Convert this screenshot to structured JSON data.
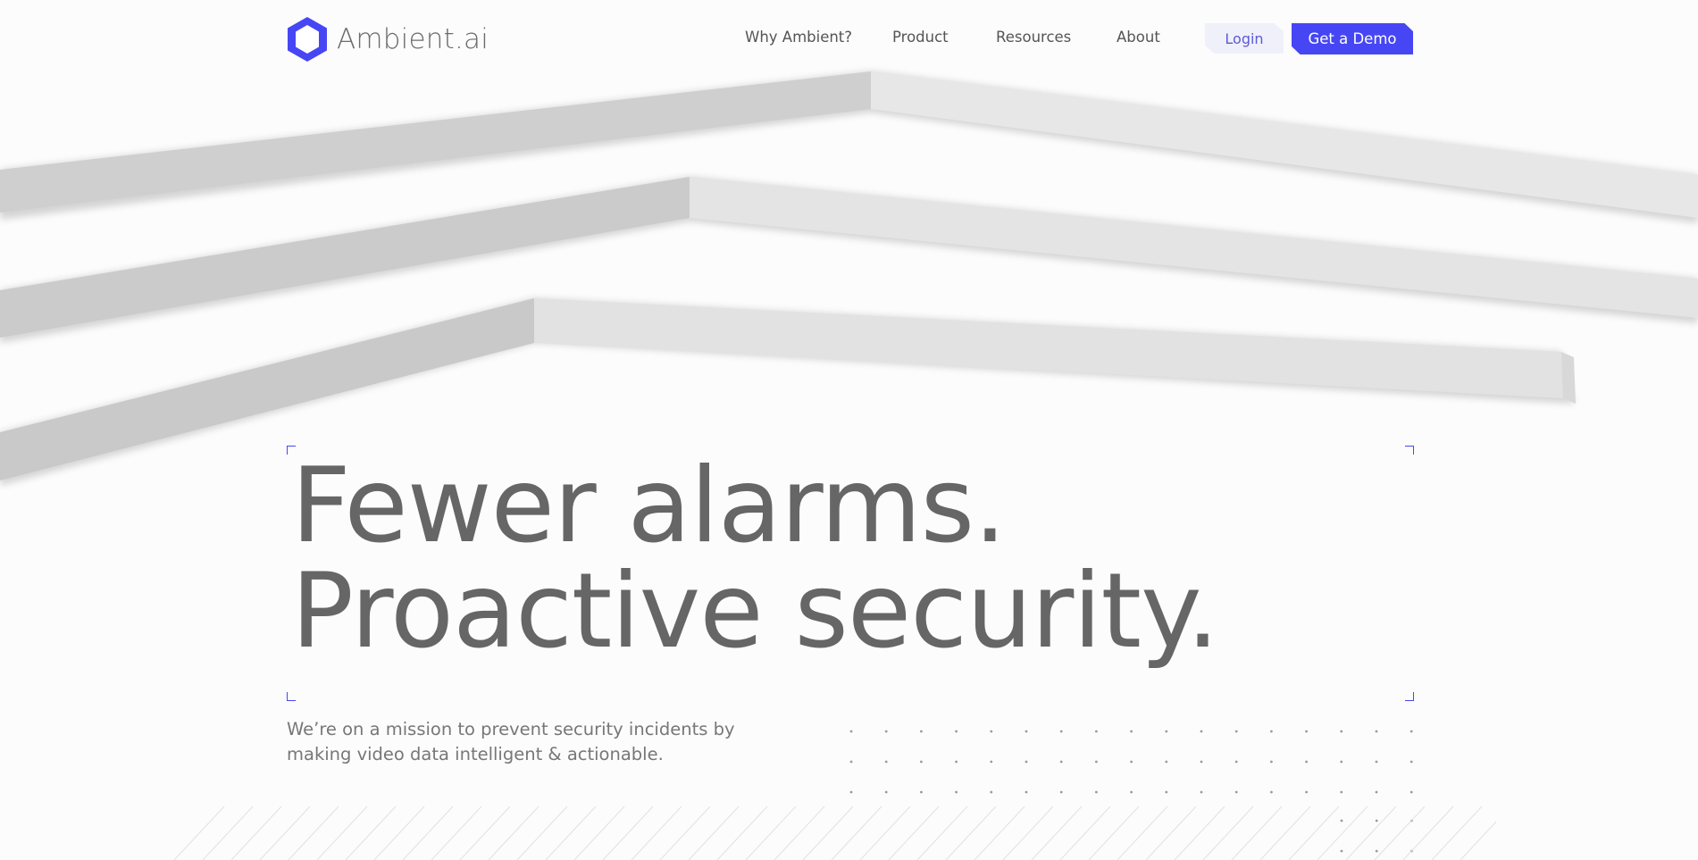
{
  "brand": {
    "name": "Ambient.ai",
    "logo_icon": "hexagon-logo-icon",
    "accent_color": "#4646f5"
  },
  "nav": {
    "links": [
      {
        "label": "Why Ambient?"
      },
      {
        "label": "Product"
      },
      {
        "label": "Resources"
      },
      {
        "label": "About"
      }
    ],
    "login_label": "Login",
    "demo_label": "Get a Demo"
  },
  "hero": {
    "headline_line1": "Fewer alarms.",
    "headline_line2": "Proactive security.",
    "subtext": "We’re on a mission to prevent security incidents by making video data intelligent & actionable."
  }
}
